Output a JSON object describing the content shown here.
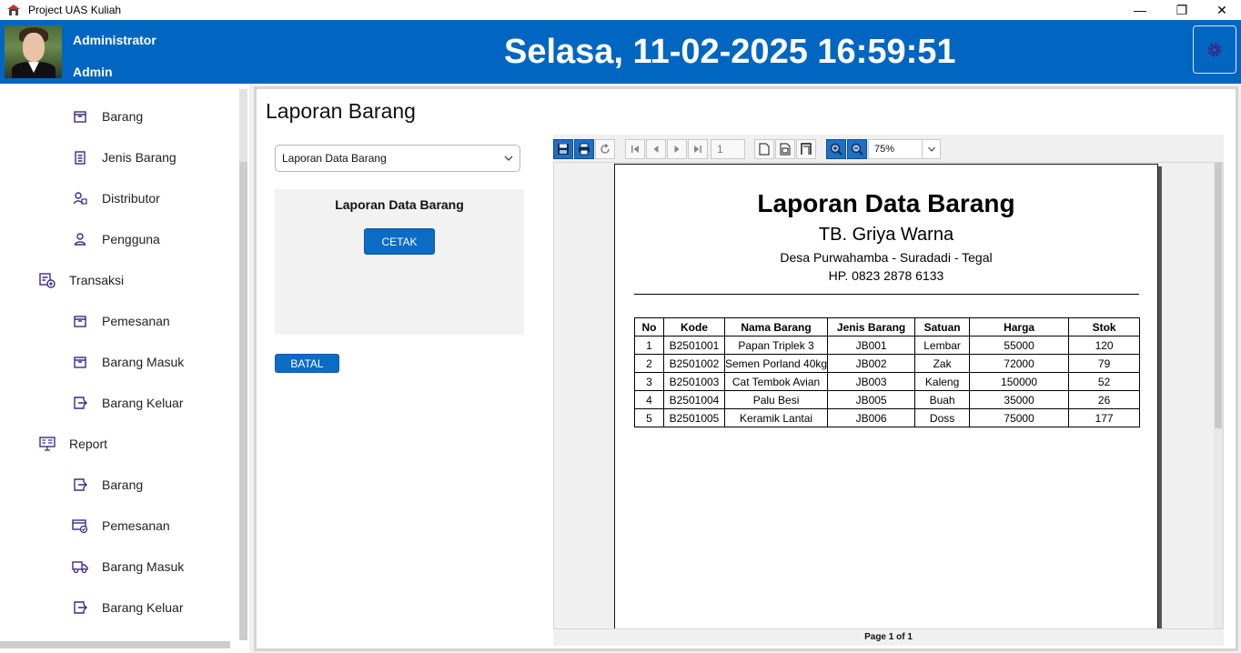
{
  "window": {
    "title": "Project UAS Kuliah",
    "minimize": "—",
    "maximize": "❐",
    "close": "✕"
  },
  "header": {
    "user_name": "Administrator",
    "user_role": "Admin",
    "datetime": "Selasa, 11-02-2025 16:59:51",
    "accent_color": "#0066c2"
  },
  "sidebar": {
    "items": [
      {
        "label": "Barang",
        "icon": "box-icon",
        "level": 2
      },
      {
        "label": "Jenis Barang",
        "icon": "clipboard-list-icon",
        "level": 2
      },
      {
        "label": "Distributor",
        "icon": "user-card-icon",
        "level": 2
      },
      {
        "label": "Pengguna",
        "icon": "user-icon",
        "level": 2
      },
      {
        "label": "Transaksi",
        "icon": "transaction-icon",
        "level": 1
      },
      {
        "label": "Pemesanan",
        "icon": "box-icon",
        "level": 2
      },
      {
        "label": "Barang Masuk",
        "icon": "box-icon",
        "level": 2
      },
      {
        "label": "Barang Keluar",
        "icon": "export-icon",
        "level": 2
      },
      {
        "label": "Report",
        "icon": "report-icon",
        "level": 1
      },
      {
        "label": "Barang",
        "icon": "export-icon",
        "level": 2
      },
      {
        "label": "Pemesanan",
        "icon": "cart-check-icon",
        "level": 2
      },
      {
        "label": "Barang Masuk",
        "icon": "truck-icon",
        "level": 2
      },
      {
        "label": "Barang Keluar",
        "icon": "export-icon",
        "level": 2
      }
    ]
  },
  "main": {
    "title": "Laporan Barang",
    "report_select": "Laporan Data Barang",
    "panel_title": "Laporan Data Barang",
    "print_button": "CETAK",
    "cancel_button": "BATAL"
  },
  "viewer": {
    "page_number": "1",
    "zoom": "75%",
    "status": "Page 1 of 1",
    "report": {
      "title": "Laporan Data Barang",
      "company": "TB. Griya Warna",
      "address": "Desa Purwahamba - Suradadi - Tegal",
      "phone": "HP. 0823 2878 6133",
      "columns": [
        "No",
        "Kode",
        "Nama Barang",
        "Jenis Barang",
        "Satuan",
        "Harga",
        "Stok"
      ],
      "rows": [
        [
          "1",
          "B2501001",
          "Papan Triplek 3",
          "JB001",
          "Lembar",
          "55000",
          "120"
        ],
        [
          "2",
          "B2501002",
          "Semen Porland 40kg",
          "JB002",
          "Zak",
          "72000",
          "79"
        ],
        [
          "3",
          "B2501003",
          "Cat Tembok Avian",
          "JB003",
          "Kaleng",
          "150000",
          "52"
        ],
        [
          "4",
          "B2501004",
          "Palu Besi",
          "JB005",
          "Buah",
          "35000",
          "26"
        ],
        [
          "5",
          "B2501005",
          "Keramik Lantai",
          "JB006",
          "Doss",
          "75000",
          "177"
        ]
      ]
    }
  }
}
